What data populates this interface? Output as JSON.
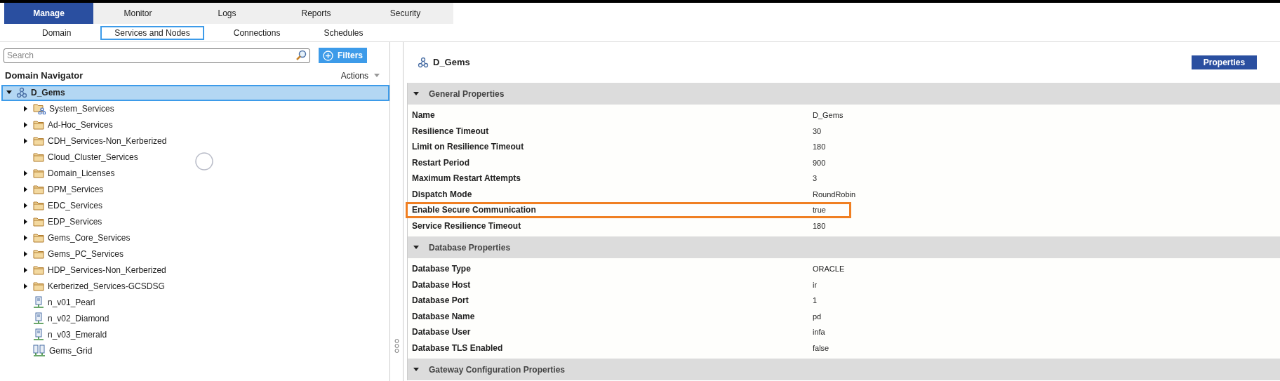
{
  "main_tabs": [
    {
      "label": "Manage",
      "selected": true
    },
    {
      "label": "Monitor",
      "selected": false
    },
    {
      "label": "Logs",
      "selected": false
    },
    {
      "label": "Reports",
      "selected": false
    },
    {
      "label": "Security",
      "selected": false
    }
  ],
  "sub_tabs": [
    {
      "label": "Domain",
      "selected": false
    },
    {
      "label": "Services and Nodes",
      "selected": true
    },
    {
      "label": "Connections",
      "selected": false
    },
    {
      "label": "Schedules",
      "selected": false
    }
  ],
  "navigator": {
    "search": {
      "placeholder": "Search"
    },
    "filters_button": "Filters",
    "title": "Domain Navigator",
    "actions": "Actions",
    "tree": [
      {
        "label": "D_Gems",
        "kind": "domain",
        "selected": true,
        "expanded": true,
        "children": [
          {
            "label": "System_Services",
            "kind": "system",
            "selected": false,
            "expanded": false
          },
          {
            "label": "Ad-Hoc_Services",
            "kind": "folder",
            "selected": false,
            "expanded": false
          },
          {
            "label": "CDH_Services-Non_Kerberized",
            "kind": "folder",
            "selected": false,
            "expanded": false
          },
          {
            "label": "Cloud_Cluster_Services",
            "kind": "folder",
            "selected": false
          },
          {
            "label": "Domain_Licenses",
            "kind": "folder",
            "selected": false,
            "expanded": false
          },
          {
            "label": "DPM_Services",
            "kind": "folder",
            "selected": false,
            "expanded": false
          },
          {
            "label": "EDC_Services",
            "kind": "folder",
            "selected": false,
            "expanded": false
          },
          {
            "label": "EDP_Services",
            "kind": "folder",
            "selected": false,
            "expanded": false
          },
          {
            "label": "Gems_Core_Services",
            "kind": "folder",
            "selected": false,
            "expanded": false
          },
          {
            "label": "Gems_PC_Services",
            "kind": "folder",
            "selected": false,
            "expanded": false
          },
          {
            "label": "HDP_Services-Non_Kerberized",
            "kind": "folder",
            "selected": false,
            "expanded": false
          },
          {
            "label": "Kerberized_Services-GCSDSG",
            "kind": "folder",
            "selected": false,
            "expanded": false
          },
          {
            "label": "n_v01_Pearl",
            "kind": "node",
            "selected": false
          },
          {
            "label": "n_v02_Diamond",
            "kind": "node",
            "selected": false
          },
          {
            "label": "n_v03_Emerald",
            "kind": "node",
            "selected": false
          },
          {
            "label": "Gems_Grid",
            "kind": "grid",
            "selected": false
          }
        ]
      }
    ]
  },
  "details": {
    "title": "D_Gems",
    "properties_button": "Properties",
    "sections": [
      {
        "title": "General Properties",
        "expanded": true,
        "rows": [
          {
            "name": "Name",
            "value": "D_Gems",
            "highlighted": false
          },
          {
            "name": "Resilience Timeout",
            "value": "30",
            "highlighted": false
          },
          {
            "name": "Limit on Resilience Timeout",
            "value": "180",
            "highlighted": false
          },
          {
            "name": "Restart Period",
            "value": "900",
            "highlighted": false
          },
          {
            "name": "Maximum Restart Attempts",
            "value": "3",
            "highlighted": false
          },
          {
            "name": "Dispatch Mode",
            "value": "RoundRobin",
            "highlighted": false
          },
          {
            "name": "Enable Secure Communication",
            "value": "true",
            "highlighted": true
          },
          {
            "name": "Service Resilience Timeout",
            "value": "180",
            "highlighted": false
          }
        ]
      },
      {
        "title": "Database Properties",
        "expanded": true,
        "rows": [
          {
            "name": "Database Type",
            "value": "ORACLE",
            "highlighted": false
          },
          {
            "name": "Database Host",
            "value": "ir",
            "highlighted": false
          },
          {
            "name": "Database Port",
            "value": "1",
            "highlighted": false
          },
          {
            "name": "Database Name",
            "value": "pd",
            "highlighted": false
          },
          {
            "name": "Database User",
            "value": "infa",
            "highlighted": false
          },
          {
            "name": "Database TLS Enabled",
            "value": "false",
            "highlighted": false
          }
        ]
      },
      {
        "title": "Gateway Configuration Properties",
        "expanded": true
      }
    ]
  }
}
